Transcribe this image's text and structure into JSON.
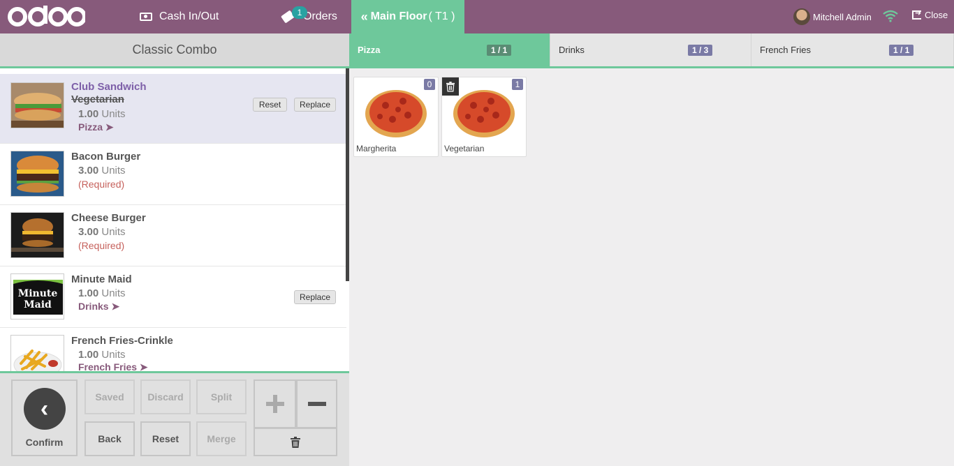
{
  "topbar": {
    "brand": "odoo",
    "cash_label": "Cash In/Out",
    "orders_label": "Orders",
    "orders_count": "1",
    "floor_label": "Main Floor",
    "table_label": "( T1 )",
    "user_name": "Mitchell Admin",
    "close_label": "Close"
  },
  "combo_title": "Classic Combo",
  "lines": [
    {
      "name": "Club Sandwich",
      "variant": "Vegetarian",
      "qty": "1.00",
      "unit": "Units",
      "category": "Pizza",
      "reset_label": "Reset",
      "replace_label": "Replace"
    },
    {
      "name": "Bacon Burger",
      "qty": "3.00",
      "unit": "Units",
      "note": "(Required)"
    },
    {
      "name": "Cheese Burger",
      "qty": "3.00",
      "unit": "Units",
      "note": "(Required)"
    },
    {
      "name": "Minute Maid",
      "qty": "1.00",
      "unit": "Units",
      "category": "Drinks",
      "replace_label": "Replace"
    },
    {
      "name": "French Fries-Crinkle",
      "qty": "1.00",
      "unit": "Units",
      "category": "French Fries"
    }
  ],
  "controls": {
    "confirm": "Confirm",
    "saved": "Saved",
    "discard": "Discard",
    "split": "Split",
    "back": "Back",
    "reset": "Reset",
    "merge": "Merge"
  },
  "tabs": [
    {
      "label": "Pizza",
      "count": "1 / 1"
    },
    {
      "label": "Drinks",
      "count": "1 / 3"
    },
    {
      "label": "French Fries",
      "count": "1 / 1"
    }
  ],
  "products": [
    {
      "name": "Margherita",
      "count": "0"
    },
    {
      "name": "Vegetarian",
      "count": "1"
    }
  ],
  "colors": {
    "brand": "#875a7b",
    "accent": "#6ec89b",
    "badge": "#7a7aa5"
  }
}
